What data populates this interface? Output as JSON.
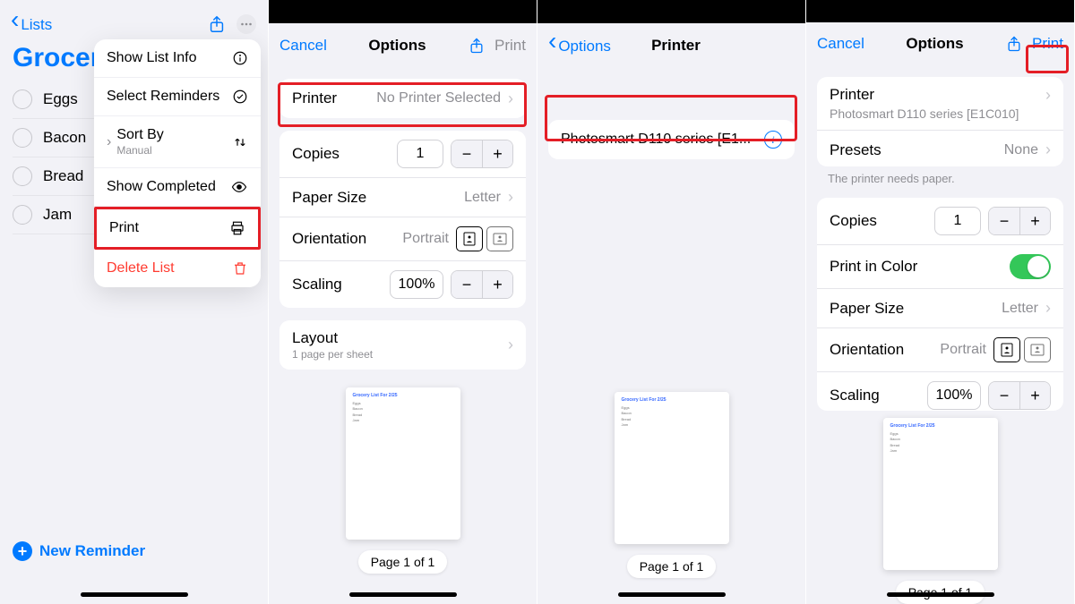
{
  "panel1": {
    "back_label": "Lists",
    "title": "Grocery",
    "items": [
      "Eggs",
      "Bacon",
      "Bread",
      "Jam"
    ],
    "menu": {
      "show_list_info": "Show List Info",
      "select_reminders": "Select Reminders",
      "sort_by": "Sort By",
      "sort_by_sub": "Manual",
      "show_completed": "Show Completed",
      "print": "Print",
      "delete_list": "Delete List"
    },
    "new_reminder": "New Reminder"
  },
  "panel2": {
    "cancel": "Cancel",
    "title": "Options",
    "print": "Print",
    "printer_label": "Printer",
    "printer_value": "No Printer Selected",
    "copies_label": "Copies",
    "copies_value": "1",
    "paper_size_label": "Paper Size",
    "paper_size_value": "Letter",
    "orientation_label": "Orientation",
    "orientation_value": "Portrait",
    "scaling_label": "Scaling",
    "scaling_value": "100%",
    "layout_label": "Layout",
    "layout_sub": "1 page per sheet",
    "preview_title": "Grocery List For 2/25",
    "page_indicator": "Page 1 of 1"
  },
  "panel3": {
    "back_label": "Options",
    "title": "Printer",
    "printer_name": "Photosmart D110 series [E1...",
    "preview_title": "Grocery List For 2/25",
    "page_indicator": "Page 1 of 1"
  },
  "panel4": {
    "cancel": "Cancel",
    "title": "Options",
    "print": "Print",
    "printer_label": "Printer",
    "printer_value": "Photosmart D110 series [E1C010]",
    "presets_label": "Presets",
    "presets_value": "None",
    "status_note": "The printer needs paper.",
    "copies_label": "Copies",
    "copies_value": "1",
    "color_label": "Print in Color",
    "paper_size_label": "Paper Size",
    "paper_size_value": "Letter",
    "orientation_label": "Orientation",
    "orientation_value": "Portrait",
    "scaling_label": "Scaling",
    "scaling_value": "100%",
    "preview_title": "Grocery List For 2/25",
    "page_indicator": "Page 1 of 1"
  }
}
